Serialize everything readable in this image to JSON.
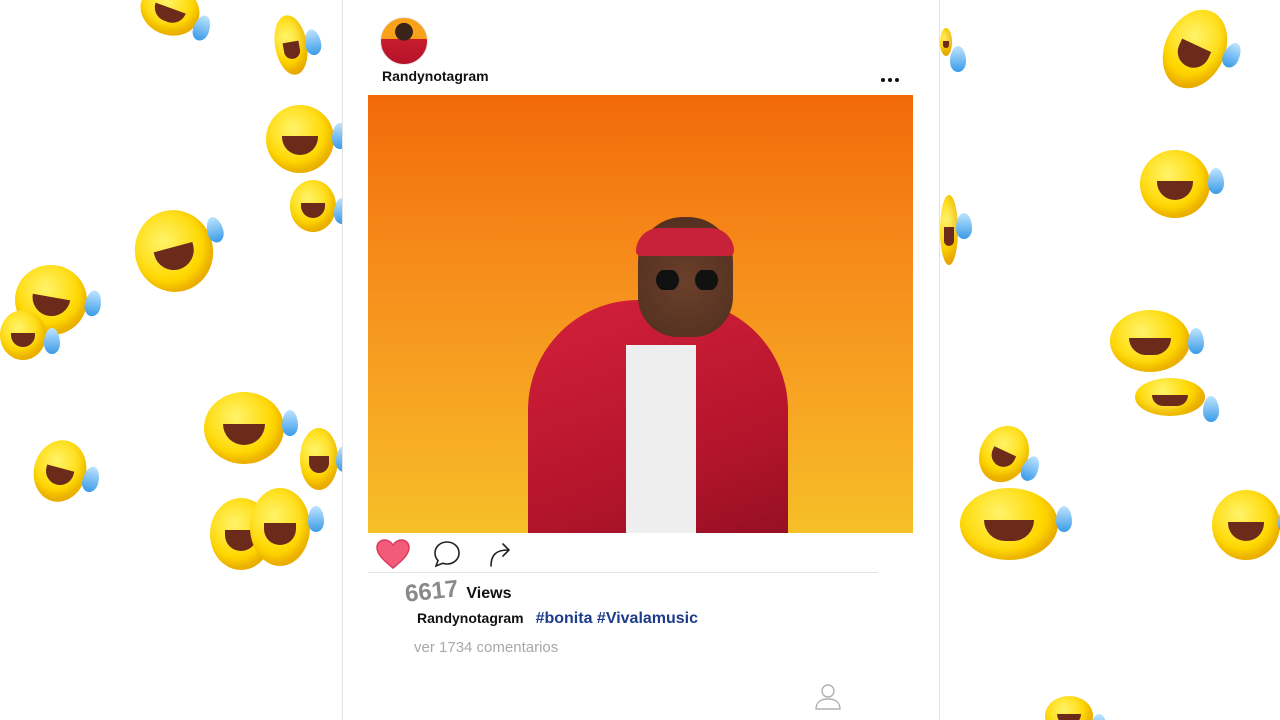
{
  "post": {
    "username": "Randynotagram",
    "views_count": "6617",
    "views_label": "Views",
    "caption_username": "Randynotagram",
    "hashtags": "#bonita #Vivalamusic",
    "comments_link": "ver 1734 comentarios"
  },
  "icons": {
    "like": "heart-icon",
    "comment": "comment-bubble-icon",
    "share": "share-arrow-icon",
    "more": "more-dots-icon",
    "profile": "user-icon"
  },
  "colors": {
    "like_active": "#f25b7a",
    "hashtag": "#1c3b8a",
    "muted_text": "#a8a8a8",
    "photo_background": "#f26a08"
  }
}
